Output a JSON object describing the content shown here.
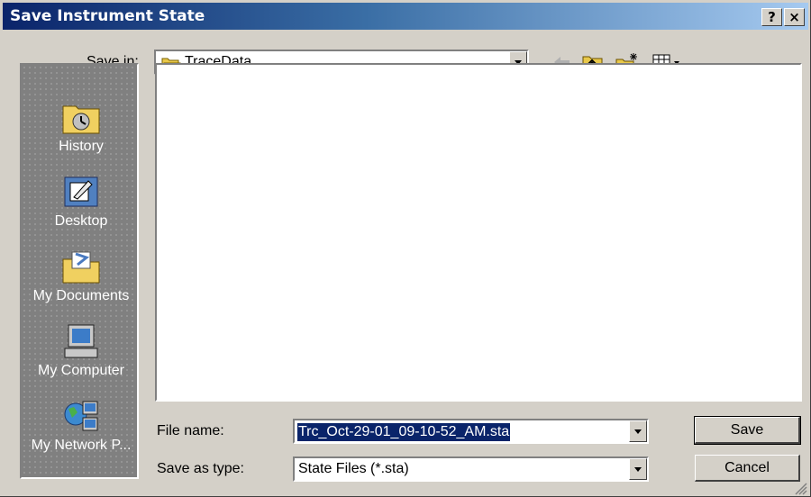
{
  "window": {
    "title": "Save Instrument State",
    "help_label": "?",
    "close_label": "×"
  },
  "save_in": {
    "label": "Save in:",
    "value": "TraceData"
  },
  "places": [
    {
      "label": "History",
      "icon": "history-icon"
    },
    {
      "label": "Desktop",
      "icon": "desktop-icon"
    },
    {
      "label": "My Documents",
      "icon": "my-documents-icon"
    },
    {
      "label": "My Computer",
      "icon": "my-computer-icon"
    },
    {
      "label": "My Network P...",
      "icon": "my-network-places-icon"
    }
  ],
  "file_name": {
    "label": "File name:",
    "value": "Trc_Oct-29-01_09-10-52_AM.sta"
  },
  "save_type": {
    "label": "Save as type:",
    "value": "State Files (*.sta)"
  },
  "buttons": {
    "save": "Save",
    "cancel": "Cancel"
  },
  "colors": {
    "title_start": "#0a246a",
    "title_end": "#a6caf0",
    "selection": "#0a246a",
    "face": "#d4d0c8"
  }
}
